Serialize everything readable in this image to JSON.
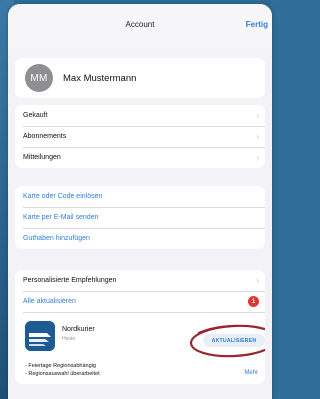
{
  "nav": {
    "title": "Account",
    "done": "Fertig"
  },
  "profile": {
    "initials": "MM",
    "name": "Max Mustermann"
  },
  "purchases": [
    {
      "label": "Gekauft"
    },
    {
      "label": "Abonnements"
    },
    {
      "label": "Mitteilungen"
    }
  ],
  "links": [
    {
      "label": "Karte oder Code einlösen"
    },
    {
      "label": "Karte per E-Mail senden"
    },
    {
      "label": "Guthaben hinzufügen"
    }
  ],
  "personalized": {
    "label": "Personalisierte Empfehlungen"
  },
  "update_all": {
    "label": "Alle aktualisieren",
    "badge": "1"
  },
  "app": {
    "name": "Nordkurier",
    "date": "Heute",
    "button": "AKTUALISIEREN",
    "notes": [
      "- Feiertage Regionsabhängig",
      "- Regionsauswahl überarbeitet"
    ],
    "more": "Mehr"
  },
  "colors": {
    "accent": "#2f7fd9",
    "badge": "#e3342f",
    "annotation": "#9b2530"
  }
}
